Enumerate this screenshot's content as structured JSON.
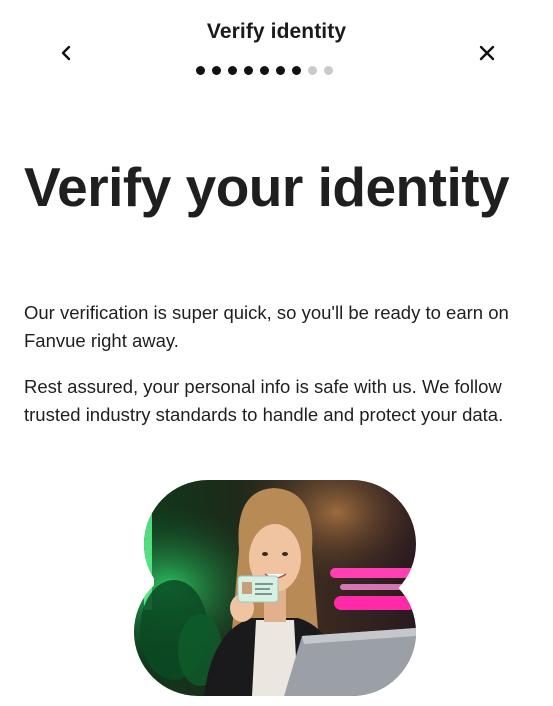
{
  "header": {
    "title": "Verify identity",
    "steps_total": 9,
    "steps_completed": 7,
    "back_icon": "chevron-left-icon",
    "close_icon": "close-icon"
  },
  "main": {
    "headline": "Verify your identity",
    "paragraphs": [
      "Our verification is super quick, so you'll be ready to earn on Fanvue right away.",
      "Rest assured, your personal info is safe with us. We follow trusted industry standards to handle and protect your data."
    ]
  },
  "colors": {
    "accent_dark": "#111111",
    "step_inactive": "#c9c9c9"
  }
}
